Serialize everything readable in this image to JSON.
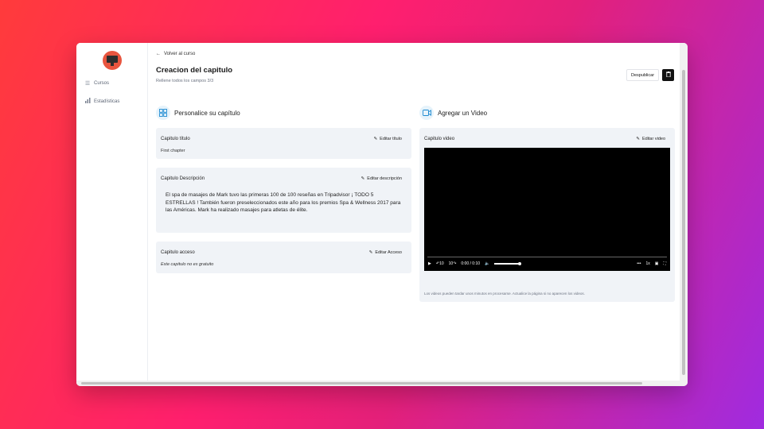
{
  "sidebar": {
    "items": [
      {
        "icon": "list-icon",
        "label": "Cursos"
      },
      {
        "icon": "bar-chart-icon",
        "label": "Estadísticas"
      }
    ]
  },
  "header": {
    "back_label": "Volver al curso",
    "title": "Creacion del capitulo",
    "subtitle": "Rellene todos los campos 3/3",
    "unpublish_label": "Despublicar"
  },
  "customize": {
    "heading": "Personalice su capítulo",
    "title_card": {
      "label": "Capitulo título",
      "edit_label": "Editar título",
      "value": "First chapter"
    },
    "description_card": {
      "label": "Capitulo Descripción",
      "edit_label": "Editar descripción",
      "value": "El spa de masajes de Mark tuvo las primeras 100 de 100 reseñas en Tripadvisor ¡ TODO 5 ESTRELLAS ! También fueron preseleccionados este año para los premios Spa & Wellness 2017 para las Américas. Mark ha realizado masajes para atletas de élite."
    },
    "access_card": {
      "label": "Capitulo acceso",
      "edit_label": "Editar Acceso",
      "value": "Este capitulo no es gratuito"
    }
  },
  "video_section": {
    "heading": "Agregar un Video",
    "card_label": "Capitulo video",
    "edit_label": "Editar video",
    "player": {
      "rewind": "10",
      "forward": "10",
      "time": "0:00 / 0:10",
      "speed": "1x",
      "progress": 0
    },
    "note": "Los videos pueden tardar unos minutos en procesarse. Actualice la página si no aparecen los videos."
  },
  "colors": {
    "accent": "#1d8ad1",
    "card_bg": "#f0f3f7"
  }
}
